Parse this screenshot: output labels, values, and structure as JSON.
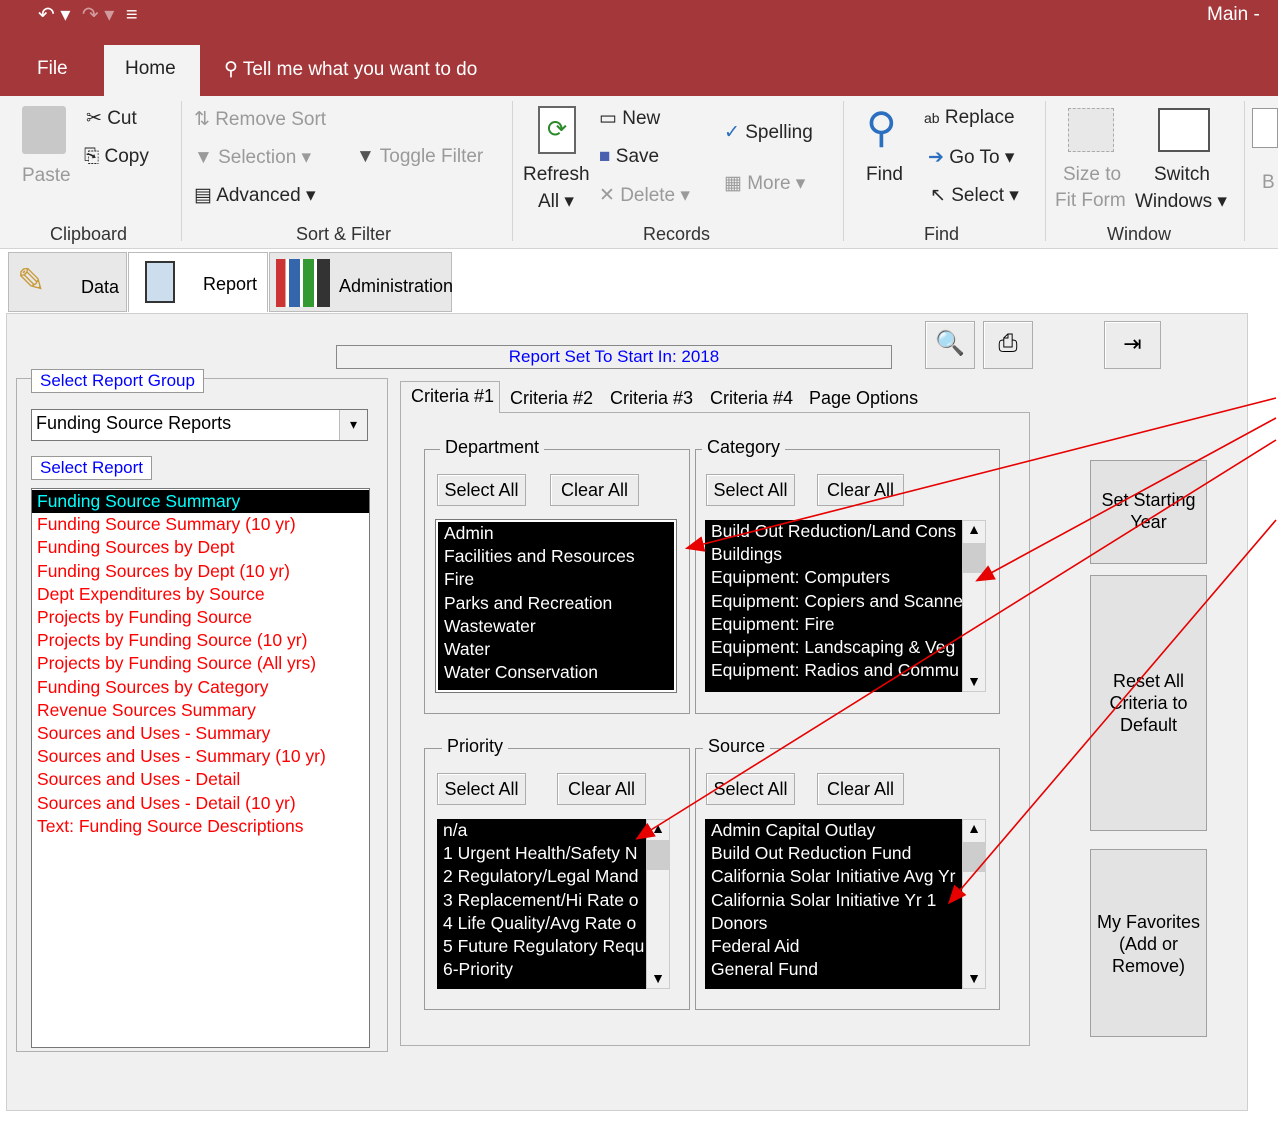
{
  "window": {
    "title": "Main -"
  },
  "menu": {
    "file": "File",
    "home": "Home",
    "tellme": "Tell me what you want to do"
  },
  "ribbon": {
    "clipboard": {
      "paste": "Paste",
      "cut": "Cut",
      "copy": "Copy",
      "label": "Clipboard"
    },
    "sort_filter": {
      "remove_sort": "Remove Sort",
      "selection": "Selection",
      "toggle_filter": "Toggle Filter",
      "advanced": "Advanced",
      "label": "Sort & Filter"
    },
    "records": {
      "refresh": "Refresh",
      "refresh2": "All",
      "new": "New",
      "save": "Save",
      "delete": "Delete",
      "spelling": "Spelling",
      "more": "More",
      "label": "Records"
    },
    "find": {
      "find": "Find",
      "replace": "Replace",
      "goto": "Go To",
      "select": "Select",
      "label": "Find"
    },
    "window": {
      "size1": "Size to",
      "size2": "Fit Form",
      "switch1": "Switch",
      "switch2": "Windows",
      "label": "Window"
    },
    "extra": "B"
  },
  "object_tabs": {
    "data": "Data",
    "report": "Report",
    "admin": "Administration"
  },
  "form": {
    "start_label": "Report Set To Start In:  2018",
    "select_group_label": "Select Report Group",
    "group_value": "Funding Source Reports",
    "select_report_label": "Select Report",
    "reports": [
      "Funding Source Summary",
      "Funding Source Summary (10 yr)",
      "Funding Sources by Dept",
      "Funding Sources by Dept (10 yr)",
      "Dept Expenditures by Source",
      "Projects by Funding Source",
      "Projects by Funding Source (10 yr)",
      "Projects by Funding Source (All yrs)",
      "Funding Sources by Category",
      "Revenue Sources Summary",
      "Sources and Uses - Summary",
      "Sources and Uses - Summary (10 yr)",
      "Sources and Uses - Detail",
      "Sources and Uses - Detail (10 yr)",
      "Text: Funding Source Descriptions"
    ],
    "tabs": [
      "Criteria #1",
      "Criteria #2",
      "Criteria #3",
      "Criteria #4",
      "Page Options"
    ],
    "select_all": "Select All",
    "clear_all": "Clear All",
    "department": {
      "title": "Department",
      "items": [
        "Admin",
        "Facilities and Resources",
        "Fire",
        "Parks and Recreation",
        "Wastewater",
        "Water",
        "Water Conservation"
      ]
    },
    "category": {
      "title": "Category",
      "items": [
        "Build Out Reduction/Land Cons",
        "Buildings",
        "Equipment: Computers",
        "Equipment: Copiers and Scanne",
        "Equipment: Fire",
        "Equipment: Landscaping & Veg",
        "Equipment: Radios and Commu"
      ]
    },
    "priority": {
      "title": "Priority",
      "items": [
        "n/a",
        "1 Urgent Health/Safety N",
        "2 Regulatory/Legal Mand",
        "3 Replacement/Hi Rate o",
        "4 Life Quality/Avg Rate o",
        "5 Future Regulatory Requ",
        "6-Priority"
      ]
    },
    "source": {
      "title": "Source",
      "items": [
        "Admin Capital Outlay",
        "Build Out Reduction Fund",
        "California Solar Initiative Avg Yr",
        "California Solar Initiative Yr 1",
        "Donors",
        "Federal Aid",
        "General Fund"
      ]
    },
    "side": {
      "set_start1": "Set Starting",
      "set_start2": "Year",
      "reset1": "Reset All",
      "reset2": "Criteria to",
      "reset3": "Default",
      "fav1": "My Favorites",
      "fav2": "(Add or",
      "fav3": "Remove)"
    }
  },
  "colors": {
    "titlebar": "#a4373a",
    "list_bg": "#000000",
    "report_text": "#ff0000",
    "label_blue": "#0000ff",
    "arrow": "#e60000"
  }
}
